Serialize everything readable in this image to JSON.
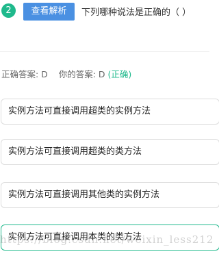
{
  "question": {
    "number": "2",
    "analysis_button": "查看解析",
    "text": "下列哪种说法是正确的（  ）"
  },
  "answer": {
    "correct_label": "正确答案: D",
    "your_label": "你的答案: D",
    "status": "(正确)"
  },
  "options": [
    {
      "text": "实例方法可直接调用超类的实例方法"
    },
    {
      "text": "实例方法可直接调用超类的类方法"
    },
    {
      "text": "实例方法可直接调用其他类的实例方法"
    },
    {
      "text": "实例方法可直接调用本类的类方法"
    }
  ],
  "watermark": "https://blog.csdn.net/weixin_less212",
  "colors": {
    "accent_green": "#1fb98c",
    "button_blue": "#4a90e2"
  }
}
